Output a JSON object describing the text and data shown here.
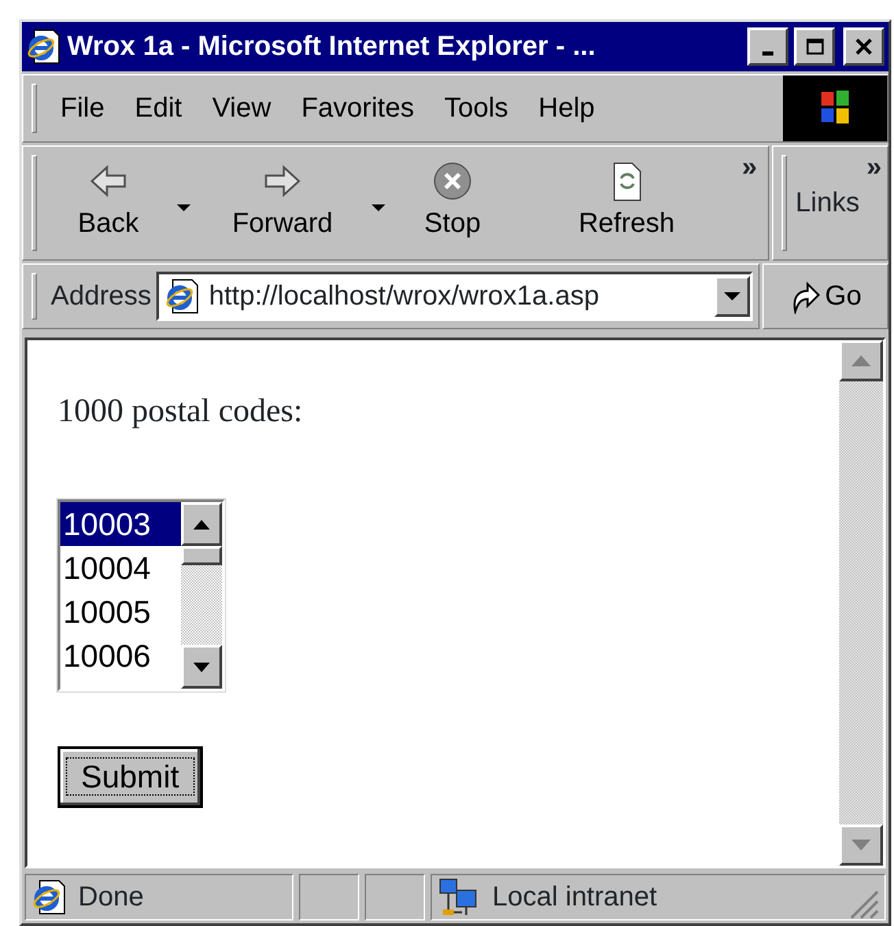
{
  "window": {
    "title": "Wrox 1a - Microsoft Internet Explorer - ..."
  },
  "menu": [
    "File",
    "Edit",
    "View",
    "Favorites",
    "Tools",
    "Help"
  ],
  "toolbar": {
    "buttons": [
      {
        "label": "Back",
        "kind": "back",
        "dropdown": true
      },
      {
        "label": "Forward",
        "kind": "forward",
        "dropdown": true
      },
      {
        "label": "Stop",
        "kind": "stop",
        "dropdown": false
      },
      {
        "label": "Refresh",
        "kind": "refresh",
        "dropdown": false
      }
    ],
    "chevron": "»"
  },
  "links": {
    "label": "Links",
    "chevron": "»"
  },
  "address": {
    "label": "Address",
    "value": "http://localhost/wrox/wrox1a.asp",
    "go": "Go"
  },
  "page": {
    "heading": "1000 postal codes:",
    "listbox": {
      "options": [
        {
          "label": "10003",
          "selected": true
        },
        {
          "label": "10004",
          "selected": false
        },
        {
          "label": "10005",
          "selected": false
        },
        {
          "label": "10006",
          "selected": false
        }
      ]
    },
    "submit": "Submit"
  },
  "status_bar": {
    "text": "Done",
    "zone": "Local intranet"
  }
}
